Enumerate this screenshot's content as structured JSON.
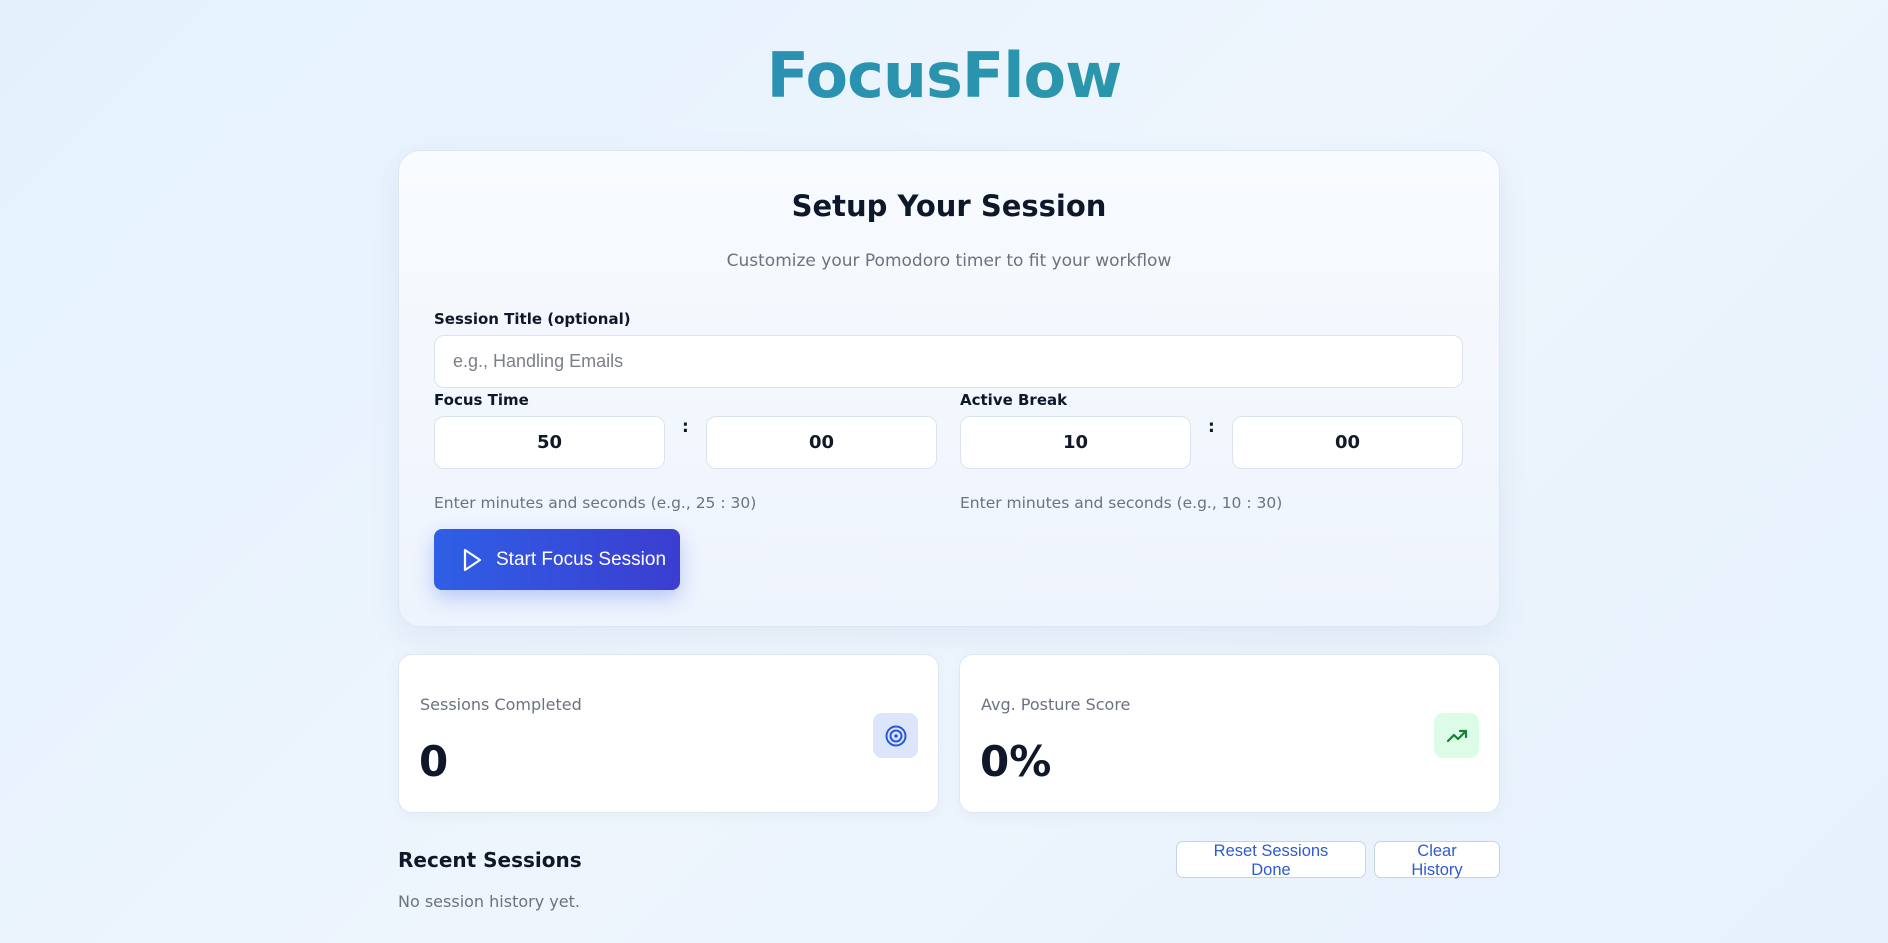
{
  "app": {
    "title": "FocusFlow"
  },
  "setup": {
    "title": "Setup Your Session",
    "subtitle": "Customize your Pomodoro timer to fit your workflow",
    "session_title_label": "Session Title (optional)",
    "session_title_placeholder": "e.g., Handling Emails",
    "session_title_value": "",
    "focus": {
      "label": "Focus Time",
      "minutes": "50",
      "seconds": "00",
      "separator": ":",
      "hint": "Enter minutes and seconds (e.g., 25 : 30)"
    },
    "break": {
      "label": "Active Break",
      "minutes": "10",
      "seconds": "00",
      "separator": ":",
      "hint": "Enter minutes and seconds (e.g., 10 : 30)"
    },
    "start_label": "Start Focus Session"
  },
  "stats": {
    "sessions": {
      "label": "Sessions Completed",
      "value": "0",
      "icon": "target-icon",
      "icon_bg": "#dbe6fd",
      "icon_color": "#2c56d6"
    },
    "posture": {
      "label": "Avg. Posture Score",
      "value": "0%",
      "icon": "trending-up-icon",
      "icon_bg": "#dcfce7",
      "icon_color": "#15803d"
    }
  },
  "recent": {
    "title": "Recent Sessions",
    "empty": "No session history yet.",
    "reset_label": "Reset Sessions Done",
    "clear_label": "Clear History"
  },
  "colors": {
    "accent": "#2f5fe6",
    "title_gradient_start": "#2b84c2",
    "title_gradient_end": "#2aa39c"
  }
}
